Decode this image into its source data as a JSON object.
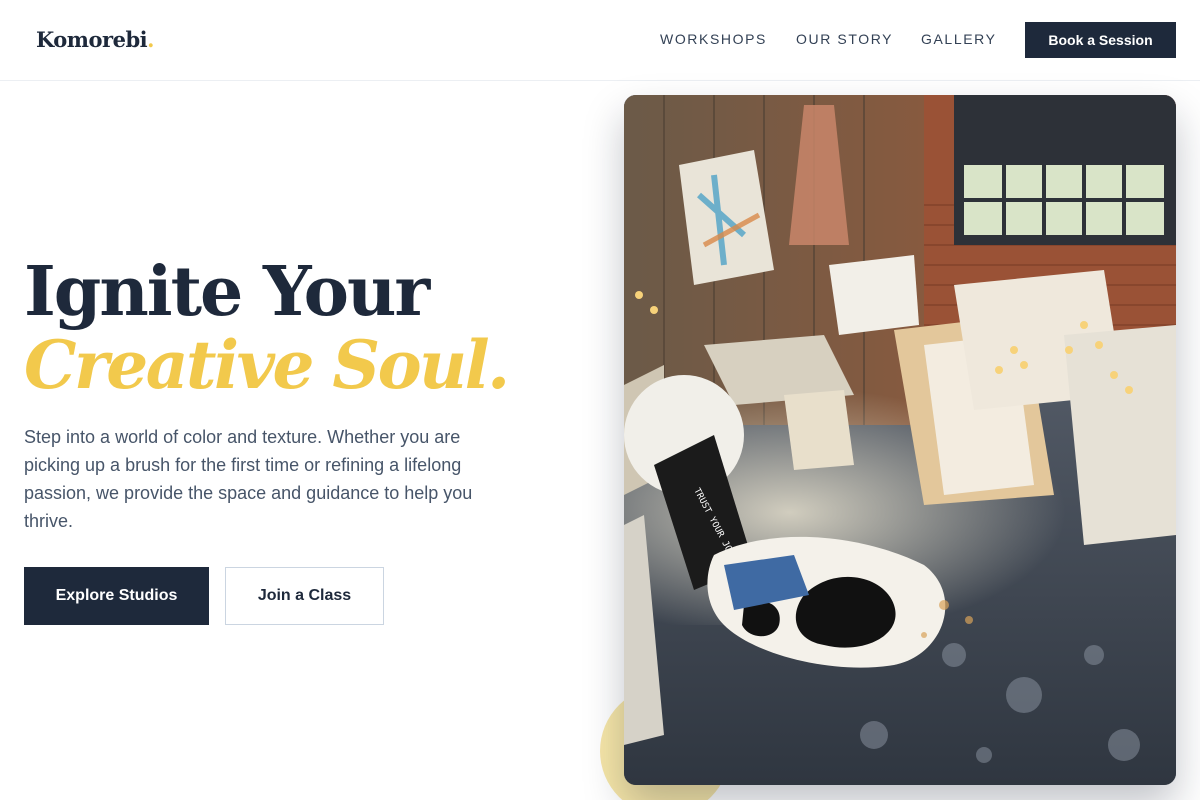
{
  "brand": {
    "name": "Komorebi",
    "dot": "."
  },
  "nav": {
    "items": [
      {
        "label": "WORKSHOPS"
      },
      {
        "label": "OUR STORY"
      },
      {
        "label": "GALLERY"
      }
    ],
    "cta_label": "Book a Session"
  },
  "hero": {
    "headline": "Ignite Your",
    "headline_accent": "Creative Soul.",
    "description": "Step into a world of color and texture. Whether you are picking up a brush for the first time or refining a lifelong passion, we provide the space and guidance to help you thrive.",
    "primary_button": "Explore Studios",
    "secondary_button": "Join a Class"
  },
  "image": {
    "subject": "art studio with canvases, chandeliers and paint-splattered floor",
    "sign_text": "TRUST YOUR JOURNEY"
  },
  "colors": {
    "navy": "#1e293b",
    "accent_yellow": "#f2c94c",
    "body_text": "#475569"
  }
}
